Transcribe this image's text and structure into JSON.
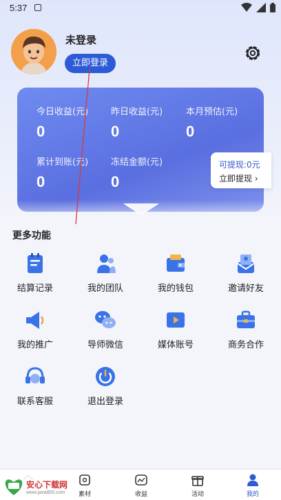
{
  "status": {
    "time": "5:37"
  },
  "profile": {
    "username": "未登录",
    "login_label": "立即登录"
  },
  "earnings": {
    "today_label": "今日收益(元)",
    "today_value": "0",
    "yesterday_label": "昨日收益(元)",
    "yesterday_value": "0",
    "month_label": "本月预估(元)",
    "month_value": "0",
    "total_label": "累计到账(元)",
    "total_value": "0",
    "frozen_label": "冻结金额(元)",
    "frozen_value": "0"
  },
  "withdraw": {
    "available_label": "可提现:0元",
    "action_label": "立即提现"
  },
  "section_title": "更多功能",
  "features": [
    {
      "label": "结算记录",
      "icon": "settlement-icon"
    },
    {
      "label": "我的团队",
      "icon": "team-icon"
    },
    {
      "label": "我的钱包",
      "icon": "wallet-icon"
    },
    {
      "label": "邀请好友",
      "icon": "invite-icon"
    },
    {
      "label": "我的推广",
      "icon": "megaphone-icon"
    },
    {
      "label": "导师微信",
      "icon": "wechat-icon"
    },
    {
      "label": "媒体账号",
      "icon": "media-icon"
    },
    {
      "label": "商务合作",
      "icon": "briefcase-icon"
    },
    {
      "label": "联系客服",
      "icon": "headset-icon"
    },
    {
      "label": "退出登录",
      "icon": "power-icon"
    }
  ],
  "tabs": [
    {
      "label": "素材",
      "icon": "material-icon"
    },
    {
      "label": "收益",
      "icon": "earnings-icon"
    },
    {
      "label": "活动",
      "icon": "gift-icon"
    },
    {
      "label": "我的",
      "icon": "profile-icon"
    }
  ],
  "watermark": {
    "title": "安心下载网",
    "url": "www.java800.com"
  },
  "colors": {
    "accent": "#2d5bd6",
    "card": "#6a80ea",
    "icon": "#3a73e8"
  }
}
